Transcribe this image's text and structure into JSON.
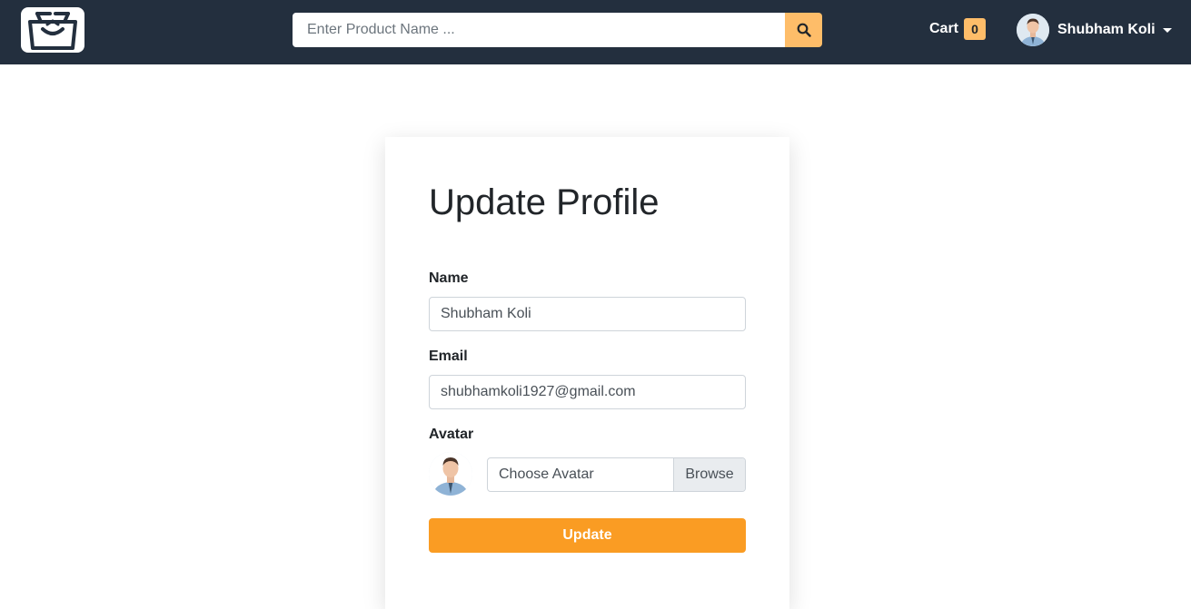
{
  "navbar": {
    "logo_icon": "shopping-bag-icon",
    "search": {
      "placeholder": "Enter Product Name ...",
      "value": "",
      "button_icon": "search-icon"
    },
    "cart": {
      "label": "Cart",
      "count": "0"
    },
    "user": {
      "name": "Shubham Koli",
      "avatar_icon": "user-avatar-photo"
    }
  },
  "form": {
    "title": "Update Profile",
    "name": {
      "label": "Name",
      "value": "Shubham Koli"
    },
    "email": {
      "label": "Email",
      "value": "shubhamkoli1927@gmail.com"
    },
    "avatar": {
      "label": "Avatar",
      "file_label": "Choose Avatar",
      "browse_label": "Browse"
    },
    "submit_label": "Update"
  },
  "colors": {
    "navbar_bg": "#232f3e",
    "accent": "#febd69",
    "button": "#fa9c23"
  }
}
